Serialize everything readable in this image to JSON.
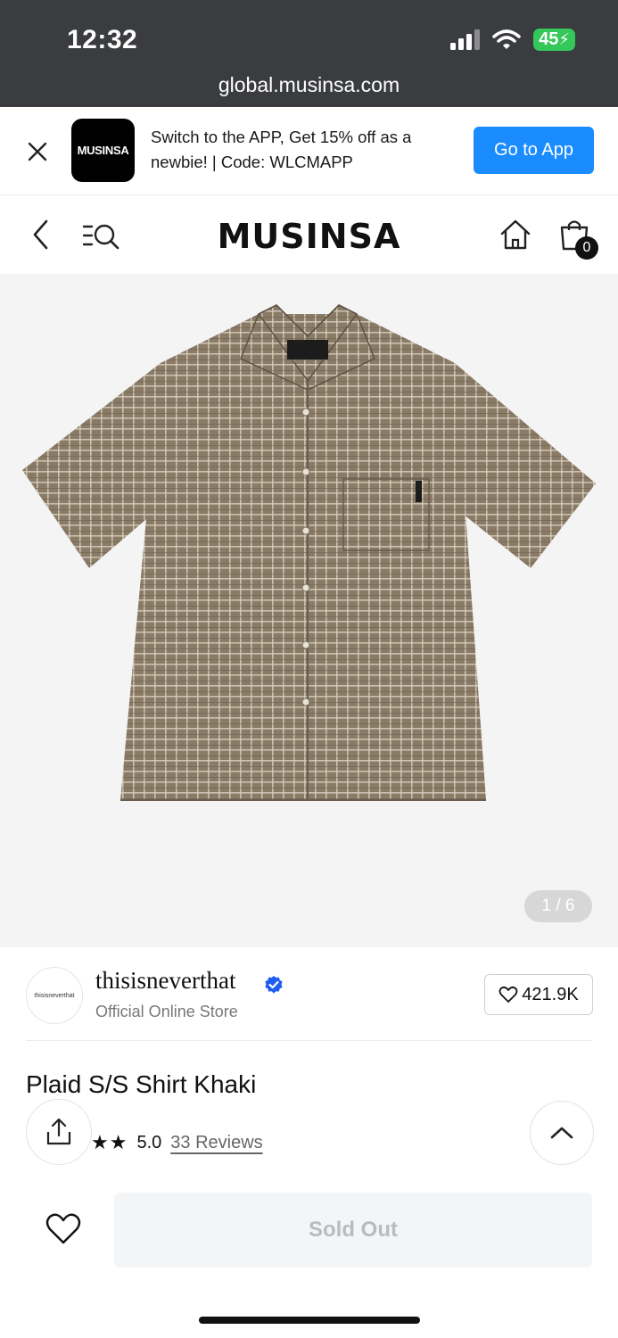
{
  "status_bar": {
    "time": "12:32",
    "battery": "45"
  },
  "browser": {
    "url": "global.musinsa.com"
  },
  "promo": {
    "app_logo_text": "MUSINSA",
    "message": "Switch to the APP, Get 15% off as a newbie! | Code: WLCMAPP",
    "button": "Go to App"
  },
  "nav": {
    "brand": "MUSINSA",
    "cart_count": "0"
  },
  "hero": {
    "counter": "1 / 6",
    "tag_text": "thisisneverthat"
  },
  "store": {
    "avatar_text": "thisisneverthat",
    "name": "thisisneverthat",
    "subtitle": "Official Online Store",
    "likes": "421.9K"
  },
  "product": {
    "name": "Plaid S/S Shirt Khaki",
    "stars": "★★",
    "rating": "5.0",
    "reviews": "33 Reviews"
  },
  "actions": {
    "buy_button": "Sold Out"
  },
  "colors": {
    "accent_blue": "#1a8cff",
    "battery_green": "#34c759",
    "verified_blue": "#1f5cf0"
  }
}
